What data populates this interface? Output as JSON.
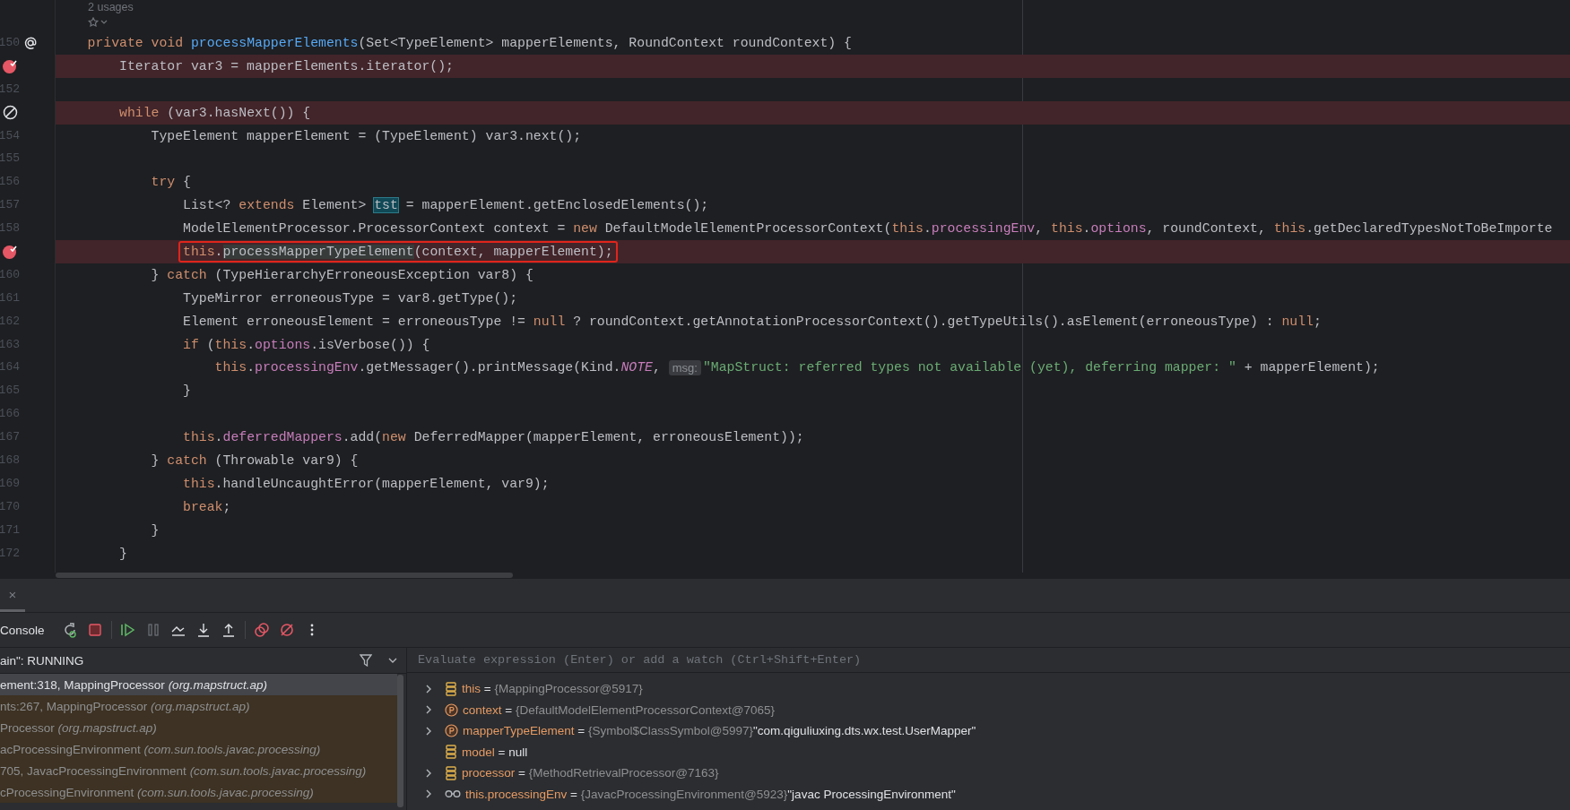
{
  "editor": {
    "usages_hint": "2 usages",
    "lines": [
      {
        "number": "150",
        "kind": "override",
        "highlighted": false,
        "tokens": [
          {
            "text": "    private",
            "kind": "keyword"
          },
          {
            "text": " void",
            "kind": "keyword"
          },
          {
            "text": " processMapperElements",
            "kind": "declaration"
          },
          {
            "text": "(Set<TypeElement> mapperElements, RoundContext roundContext) {",
            "kind": "plain"
          }
        ]
      },
      {
        "kind": "breakpoint",
        "highlighted": true,
        "tokens": [
          {
            "text": "        Iterator var3 = mapperElements.iterator();",
            "kind": "plain"
          }
        ]
      },
      {
        "number": "152",
        "kind": "plain"
      },
      {
        "kind": "disabled-breakpoint",
        "highlighted": true,
        "tokens": [
          {
            "text": "        while",
            "kind": "keyword"
          },
          {
            "text": " (var3.hasNext()) {",
            "kind": "plain"
          }
        ]
      },
      {
        "number": "154",
        "kind": "plain",
        "highlighted": false,
        "tokens": [
          {
            "text": "            TypeElement mapperElement = (TypeElement) var3.next();",
            "kind": "plain"
          }
        ]
      },
      {
        "number": "155",
        "kind": "plain"
      },
      {
        "number": "156",
        "kind": "plain",
        "highlighted": false,
        "tokens": [
          {
            "text": "            try",
            "kind": "keyword"
          },
          {
            "text": " {",
            "kind": "plain"
          }
        ]
      },
      {
        "number": "157",
        "kind": "plain",
        "highlighted": false,
        "tokens": [
          {
            "text": "                List<? ",
            "kind": "plain"
          },
          {
            "text": "extends",
            "kind": "keyword"
          },
          {
            "text": " Element> ",
            "kind": "plain"
          },
          {
            "text": "tst",
            "kind": "match"
          },
          {
            "text": " = mapperElement.getEnclosedElements();",
            "kind": "plain"
          }
        ]
      },
      {
        "number": "158",
        "kind": "plain",
        "highlighted": false,
        "tokens": [
          {
            "text": "                ModelElementProcessor.ProcessorContext context = ",
            "kind": "plain"
          },
          {
            "text": "new",
            "kind": "keyword"
          },
          {
            "text": " DefaultModelElementProcessorContext(",
            "kind": "plain"
          },
          {
            "text": "this",
            "kind": "keyword"
          },
          {
            "text": ".",
            "kind": "plain"
          },
          {
            "text": "processingEnv",
            "kind": "field"
          },
          {
            "text": ", ",
            "kind": "plain"
          },
          {
            "text": "this",
            "kind": "keyword"
          },
          {
            "text": ".",
            "kind": "plain"
          },
          {
            "text": "options",
            "kind": "field"
          },
          {
            "text": ", roundContext, ",
            "kind": "plain"
          },
          {
            "text": "this",
            "kind": "keyword"
          },
          {
            "text": ".getDeclaredTypesNotToBeImporte",
            "kind": "plain"
          }
        ]
      },
      {
        "kind": "breakpoint",
        "highlighted": true,
        "boxed": true,
        "tokens": [
          {
            "text": "                this",
            "kind": "keyword"
          },
          {
            "text": ".",
            "kind": "plain"
          },
          {
            "text": "processMapperTypeElement",
            "kind": "usage"
          },
          {
            "text": "(context, mapperElement);",
            "kind": "plain"
          }
        ]
      },
      {
        "number": "160",
        "kind": "plain",
        "highlighted": false,
        "tokens": [
          {
            "text": "            } ",
            "kind": "plain"
          },
          {
            "text": "catch",
            "kind": "keyword"
          },
          {
            "text": " (TypeHierarchyErroneousException var8) {",
            "kind": "plain"
          }
        ]
      },
      {
        "number": "161",
        "kind": "plain",
        "highlighted": false,
        "tokens": [
          {
            "text": "                TypeMirror erroneousType = var8.getType();",
            "kind": "plain"
          }
        ]
      },
      {
        "number": "162",
        "kind": "plain",
        "highlighted": false,
        "tokens": [
          {
            "text": "                Element erroneousElement = erroneousType != ",
            "kind": "plain"
          },
          {
            "text": "null",
            "kind": "keyword"
          },
          {
            "text": " ? roundContext.getAnnotationProcessorContext().getTypeUtils().asElement(erroneousType) : ",
            "kind": "plain"
          },
          {
            "text": "null",
            "kind": "keyword"
          },
          {
            "text": ";",
            "kind": "plain"
          }
        ]
      },
      {
        "number": "163",
        "kind": "plain",
        "highlighted": false,
        "tokens": [
          {
            "text": "                if",
            "kind": "keyword"
          },
          {
            "text": " (",
            "kind": "plain"
          },
          {
            "text": "this",
            "kind": "keyword"
          },
          {
            "text": ".",
            "kind": "plain"
          },
          {
            "text": "options",
            "kind": "field"
          },
          {
            "text": ".isVerbose()) {",
            "kind": "plain"
          }
        ]
      },
      {
        "number": "164",
        "kind": "plain",
        "highlighted": false,
        "tokens": [
          {
            "text": "                    this",
            "kind": "keyword"
          },
          {
            "text": ".",
            "kind": "plain"
          },
          {
            "text": "processingEnv",
            "kind": "field"
          },
          {
            "text": ".getMessager().printMessage(Kind.",
            "kind": "plain"
          },
          {
            "text": "NOTE",
            "kind": "static"
          },
          {
            "text": ", ",
            "kind": "plain"
          },
          {
            "text": "msg:",
            "kind": "hint"
          },
          {
            "text": "\"MapStruct: referred types not available (yet), deferring mapper: \"",
            "kind": "string"
          },
          {
            "text": " + mapperElement);",
            "kind": "plain"
          }
        ]
      },
      {
        "number": "165",
        "kind": "plain",
        "highlighted": false,
        "tokens": [
          {
            "text": "                }",
            "kind": "plain"
          }
        ]
      },
      {
        "number": "166",
        "kind": "plain"
      },
      {
        "number": "167",
        "kind": "plain",
        "highlighted": false,
        "tokens": [
          {
            "text": "                this",
            "kind": "keyword"
          },
          {
            "text": ".",
            "kind": "plain"
          },
          {
            "text": "deferredMappers",
            "kind": "field"
          },
          {
            "text": ".add(",
            "kind": "plain"
          },
          {
            "text": "new",
            "kind": "keyword"
          },
          {
            "text": " DeferredMapper(mapperElement, erroneousElement));",
            "kind": "plain"
          }
        ]
      },
      {
        "number": "168",
        "kind": "plain",
        "highlighted": false,
        "tokens": [
          {
            "text": "            } ",
            "kind": "plain"
          },
          {
            "text": "catch",
            "kind": "keyword"
          },
          {
            "text": " (Throwable var9) {",
            "kind": "plain"
          }
        ]
      },
      {
        "number": "169",
        "kind": "plain",
        "highlighted": false,
        "tokens": [
          {
            "text": "                this",
            "kind": "keyword"
          },
          {
            "text": ".handleUncaughtError(mapperElement, var9);",
            "kind": "plain"
          }
        ]
      },
      {
        "number": "170",
        "kind": "plain",
        "highlighted": false,
        "tokens": [
          {
            "text": "                break",
            "kind": "keyword"
          },
          {
            "text": ";",
            "kind": "plain"
          }
        ]
      },
      {
        "number": "171",
        "kind": "plain",
        "highlighted": false,
        "tokens": [
          {
            "text": "            }",
            "kind": "plain"
          }
        ]
      },
      {
        "number": "172",
        "kind": "plain",
        "highlighted": false,
        "tokens": [
          {
            "text": "        }",
            "kind": "plain"
          }
        ]
      }
    ]
  },
  "debugger": {
    "close_glyph": "×",
    "console_label": "Console",
    "thread": "ain\": RUNNING",
    "frames": [
      {
        "method": "ement:318, MappingProcessor",
        "package": "(org.mapstruct.ap)",
        "selected": true,
        "library": false
      },
      {
        "method": "nts:267, MappingProcessor",
        "package": "(org.mapstruct.ap)",
        "selected": false,
        "library": true
      },
      {
        "method": "Processor",
        "package": "(org.mapstruct.ap)",
        "selected": false,
        "library": true
      },
      {
        "method": "acProcessingEnvironment",
        "package": "(com.sun.tools.javac.processing)",
        "selected": false,
        "library": true
      },
      {
        "method": "705, JavacProcessingEnvironment",
        "package": "(com.sun.tools.javac.processing)",
        "selected": false,
        "library": true
      },
      {
        "method": "cProcessingEnvironment",
        "package": "(com.sun.tools.javac.processing)",
        "selected": false,
        "library": true
      }
    ],
    "evaluate": {
      "placeholder": "Evaluate expression (Enter) or add a watch (Ctrl+Shift+Enter)"
    },
    "variables": [
      {
        "kind": "field",
        "expandable": true,
        "name": "this",
        "equals": "=",
        "value": "{MappingProcessor@5917}"
      },
      {
        "kind": "parameter",
        "expandable": true,
        "name": "context",
        "equals": "=",
        "value": "{DefaultModelElementProcessorContext@7065}"
      },
      {
        "kind": "parameter",
        "expandable": true,
        "name": "mapperTypeElement",
        "equals": "=",
        "value": "{Symbol$ClassSymbol@5997}",
        "extra": "\"com.qiguliuxing.dts.wx.test.UserMapper\""
      },
      {
        "kind": "field",
        "expandable": false,
        "name": "model",
        "equals": "=",
        "extra": "null"
      },
      {
        "kind": "field",
        "expandable": true,
        "name": "processor",
        "equals": "=",
        "value": "{MethodRetrievalProcessor@7163}"
      },
      {
        "kind": "watch",
        "expandable": true,
        "name": "this.processingEnv",
        "equals": "=",
        "value": "{JavacProcessingEnvironment@5923}",
        "extra": "\"javac ProcessingEnvironment\""
      }
    ]
  }
}
